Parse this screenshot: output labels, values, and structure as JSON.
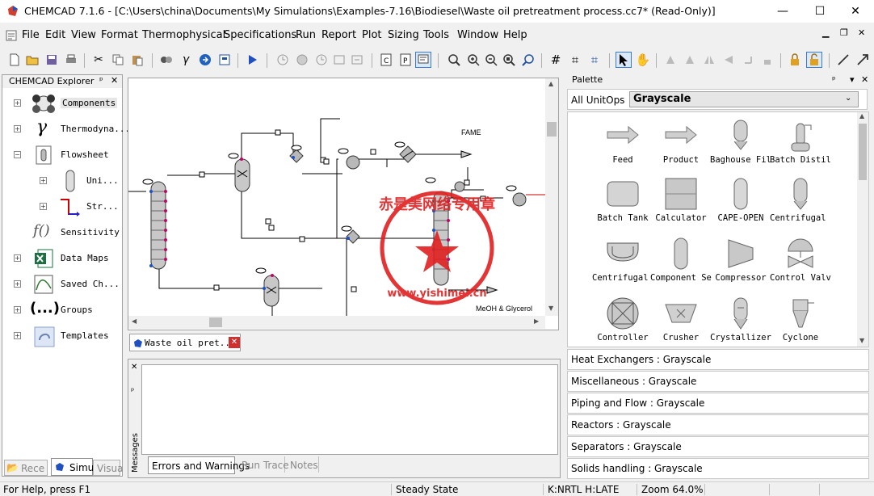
{
  "window": {
    "title": "CHEMCAD 7.1.6 - [C:\\Users\\china\\Documents\\My Simulations\\Examples-7.16\\Biodiesel\\Waste oil pretreatment process.cc7*     (Read-Only)]",
    "minimize": "—",
    "maximize": "☐",
    "close": "✕",
    "doc_min": "▁",
    "doc_restore": "❐",
    "doc_close": "✕"
  },
  "menu": [
    "File",
    "Edit",
    "View",
    "Format",
    "Thermophysical",
    "Specifications",
    "Run",
    "Report",
    "Plot",
    "Sizing",
    "Tools",
    "Window",
    "Help"
  ],
  "explorer": {
    "title": "CHEMCAD Explorer",
    "pin": "ᵖ",
    "close": "✕",
    "items": [
      "Components",
      "Thermodyna...",
      "Flowsheet",
      "Uni...",
      "Str...",
      "Sensitivity",
      "Data Maps",
      "Saved Ch...",
      "Groups",
      "Templates"
    ],
    "bottom_tabs": [
      "Rece",
      "Simu",
      "Visua"
    ]
  },
  "flowsheet": {
    "labels": [
      "FAME",
      "MeOH & Glycerol"
    ],
    "tab_label": "Waste oil pret...",
    "stamp_text": "赤是美网络专用章",
    "stamp_url": "www.yishimei.cn"
  },
  "messages": {
    "side_label": "Messages",
    "tabs": [
      "Errors and Warnings",
      "Run Trace",
      "Notes"
    ]
  },
  "palette": {
    "title": "Palette",
    "all_unitops": "All UnitOps",
    "selected_group": "Grayscale",
    "items": [
      {
        "label": "Feed",
        "icon": "feed-arrow-icon"
      },
      {
        "label": "Product",
        "icon": "product-arrow-icon"
      },
      {
        "label": "Baghouse Filter",
        "icon": "baghouse-filter-icon"
      },
      {
        "label": "Batch Distillation",
        "icon": "batch-distillation-icon"
      },
      {
        "label": "Batch Tank",
        "icon": "batch-tank-icon"
      },
      {
        "label": "Calculator",
        "icon": "calculator-icon"
      },
      {
        "label": "CAPE-OPEN",
        "icon": "cape-open-icon"
      },
      {
        "label": "Centrifugal Filter",
        "icon": "centrifugal-filter-icon"
      },
      {
        "label": "Centrifugal Sedimentation",
        "icon": "centrifugal-sedimentation-icon"
      },
      {
        "label": "Component Separator",
        "icon": "component-separator-icon"
      },
      {
        "label": "Compressor",
        "icon": "compressor-icon"
      },
      {
        "label": "Control Valve",
        "icon": "control-valve-icon"
      },
      {
        "label": "Controller",
        "icon": "controller-icon"
      },
      {
        "label": "Crusher",
        "icon": "crusher-icon"
      },
      {
        "label": "Crystallizer",
        "icon": "crystallizer-icon"
      },
      {
        "label": "Cyclone",
        "icon": "cyclone-icon"
      }
    ],
    "categories": [
      "Heat Exchangers : Grayscale",
      "Miscellaneous : Grayscale",
      "Piping and Flow : Grayscale",
      "Reactors : Grayscale",
      "Separators : Grayscale",
      "Solids handling : Grayscale"
    ]
  },
  "status": {
    "help": "For Help, press F1",
    "state": "Steady State",
    "thermo": "K:NRTL H:LATE",
    "zoom": "Zoom 64.0%"
  },
  "colors": {
    "stamp_red": "#e02020",
    "stream_blue": "#1a4fd0",
    "nozzle_magenta": "#c8006a",
    "equipment_gray": "#b8b8b8"
  }
}
